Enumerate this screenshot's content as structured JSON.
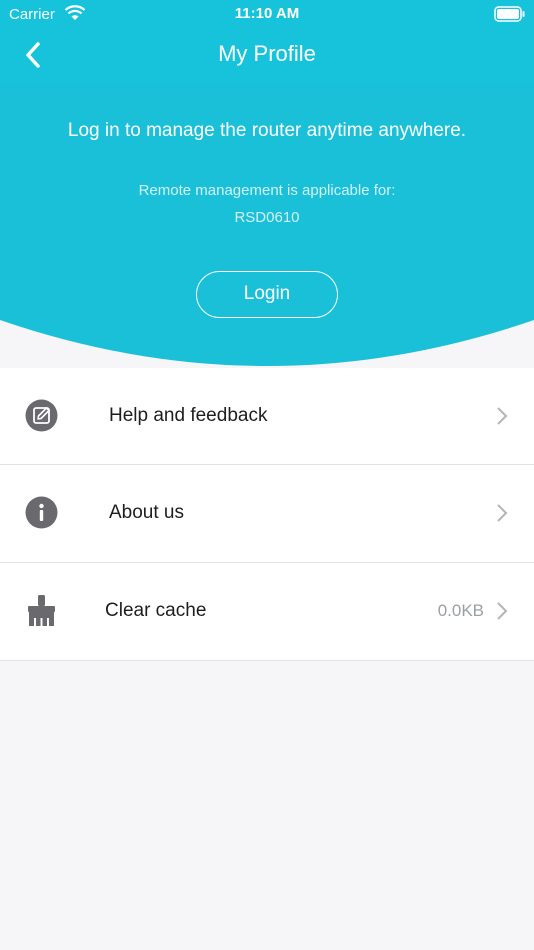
{
  "status_bar": {
    "carrier": "Carrier",
    "time": "11:10 AM"
  },
  "nav": {
    "title": "My Profile",
    "back_icon": "chevron-left-icon"
  },
  "hero": {
    "message": "Log in to manage the router anytime anywhere.",
    "remote_line1": "Remote management is applicable for:",
    "remote_line2": "RSD0610",
    "login_label": "Login"
  },
  "menu": {
    "items": [
      {
        "label": "Help and feedback",
        "icon": "edit-icon",
        "value": ""
      },
      {
        "label": "About us",
        "icon": "info-icon",
        "value": ""
      },
      {
        "label": "Clear cache",
        "icon": "brush-icon",
        "value": "0.0KB"
      }
    ]
  },
  "colors": {
    "accent": "#16c3db",
    "icon": "#6a6a6e",
    "background": "#f6f6f8"
  }
}
